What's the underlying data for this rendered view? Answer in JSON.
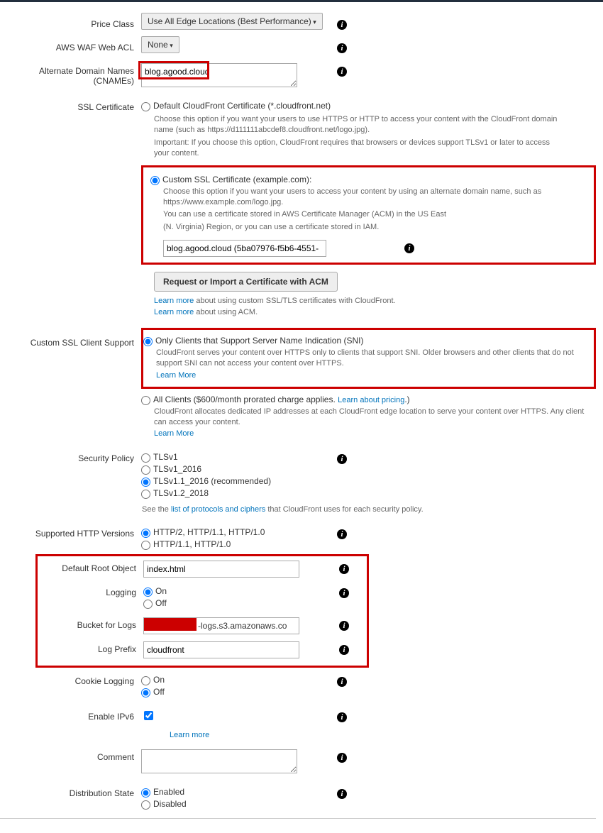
{
  "priceClass": {
    "label": "Price Class",
    "value": "Use All Edge Locations (Best Performance)"
  },
  "wafAcl": {
    "label": "AWS WAF Web ACL",
    "value": "None"
  },
  "cnames": {
    "label1": "Alternate Domain Names",
    "label2": "(CNAMEs)",
    "value": "blog.agood.cloud"
  },
  "ssl": {
    "label": "SSL Certificate",
    "defaultLabel": "Default CloudFront Certificate (*.cloudfront.net)",
    "defaultDesc1": "Choose this option if you want your users to use HTTPS or HTTP to access your content with the CloudFront domain name (such as https://d111111abcdef8.cloudfront.net/logo.jpg).",
    "defaultDesc2": "Important: If you choose this option, CloudFront requires that browsers or devices support TLSv1 or later to access your content.",
    "customLabel": "Custom SSL Certificate (example.com):",
    "customDesc1": "Choose this option if you want your users to access your content by using an alternate domain name, such as https://www.example.com/logo.jpg.",
    "customDesc2": "You can use a certificate stored in AWS Certificate Manager (ACM) in the US East",
    "customDesc3": "(N. Virginia) Region, or you can use a certificate stored in IAM.",
    "certValue": "blog.agood.cloud (5ba07976-f5b6-4551-",
    "acmButton": "Request or Import a Certificate with ACM",
    "learnMore1a": "Learn more",
    "learnMore1b": " about using custom SSL/TLS certificates with CloudFront.",
    "learnMore2a": "Learn more",
    "learnMore2b": " about using ACM."
  },
  "sni": {
    "label": "Custom SSL Client Support",
    "opt1Label": "Only Clients that Support Server Name Indication (SNI)",
    "opt1Desc": "CloudFront serves your content over HTTPS only to clients that support SNI. Older browsers and other clients that do not support SNI can not access your content over HTTPS.",
    "learnMoreLink": "Learn More",
    "opt2Label": "All Clients ($600/month prorated charge applies. ",
    "opt2PricingLink": "Learn about pricing",
    "opt2Close": ".)",
    "opt2Desc": "CloudFront allocates dedicated IP addresses at each CloudFront edge location to serve your content over HTTPS. Any client can access your content.",
    "opt2LearnMore": "Learn More"
  },
  "secPolicy": {
    "label": "Security Policy",
    "opt1": "TLSv1",
    "opt2": "TLSv1_2016",
    "opt3": "TLSv1.1_2016 (recommended)",
    "opt4": "TLSv1.2_2018",
    "desc1": "See the ",
    "descLink": "list of protocols and ciphers",
    "desc2": " that CloudFront uses for each security policy."
  },
  "httpVer": {
    "label": "Supported HTTP Versions",
    "opt1": "HTTP/2, HTTP/1.1, HTTP/1.0",
    "opt2": "HTTP/1.1, HTTP/1.0"
  },
  "rootObj": {
    "label": "Default Root Object",
    "value": "index.html"
  },
  "logging": {
    "label": "Logging",
    "on": "On",
    "off": "Off"
  },
  "bucket": {
    "label": "Bucket for Logs",
    "suffix": "-logs.s3.amazonaws.co"
  },
  "logPrefix": {
    "label": "Log Prefix",
    "value": "cloudfront"
  },
  "cookieLog": {
    "label": "Cookie Logging",
    "on": "On",
    "off": "Off"
  },
  "ipv6": {
    "label": "Enable IPv6",
    "learnMore": "Learn more"
  },
  "comment": {
    "label": "Comment",
    "value": ""
  },
  "distState": {
    "label": "Distribution State",
    "on": "Enabled",
    "off": "Disabled"
  }
}
